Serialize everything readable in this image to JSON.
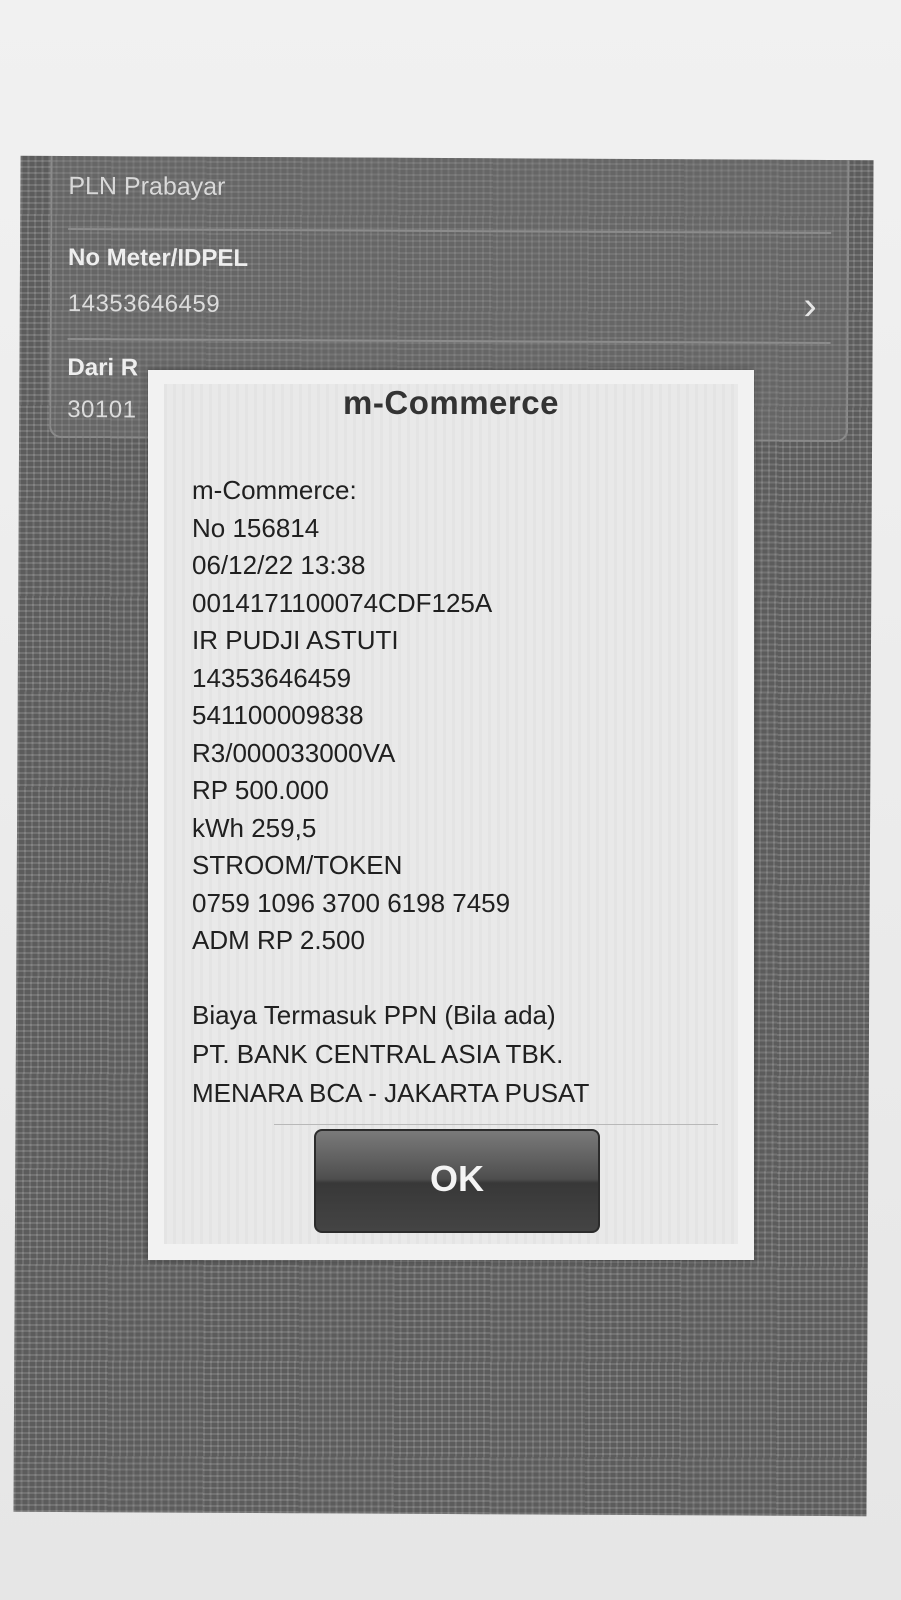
{
  "form": {
    "product": "PLN Prabayar",
    "meter_label": "No Meter/IDPEL",
    "meter_value": "14353646459",
    "source_label": "Dari R",
    "source_value": "30101"
  },
  "dialog": {
    "title": "m-Commerce",
    "lines": [
      "m-Commerce:",
      "No 156814",
      "06/12/22 13:38",
      "0014171100074CDF125A",
      "IR PUDJI ASTUTI",
      "14353646459",
      "541100009838",
      "R3/000033000VA",
      "RP 500.000",
      "kWh 259,5",
      "STROOM/TOKEN",
      "0759 1096 3700 6198 7459",
      "ADM RP 2.500"
    ],
    "footer": [
      "Biaya Termasuk PPN (Bila ada)",
      "PT. BANK CENTRAL ASIA TBK.",
      "MENARA BCA - JAKARTA PUSAT"
    ],
    "ok_label": "OK"
  },
  "icons": {
    "chevron": "chevron-right-icon"
  }
}
